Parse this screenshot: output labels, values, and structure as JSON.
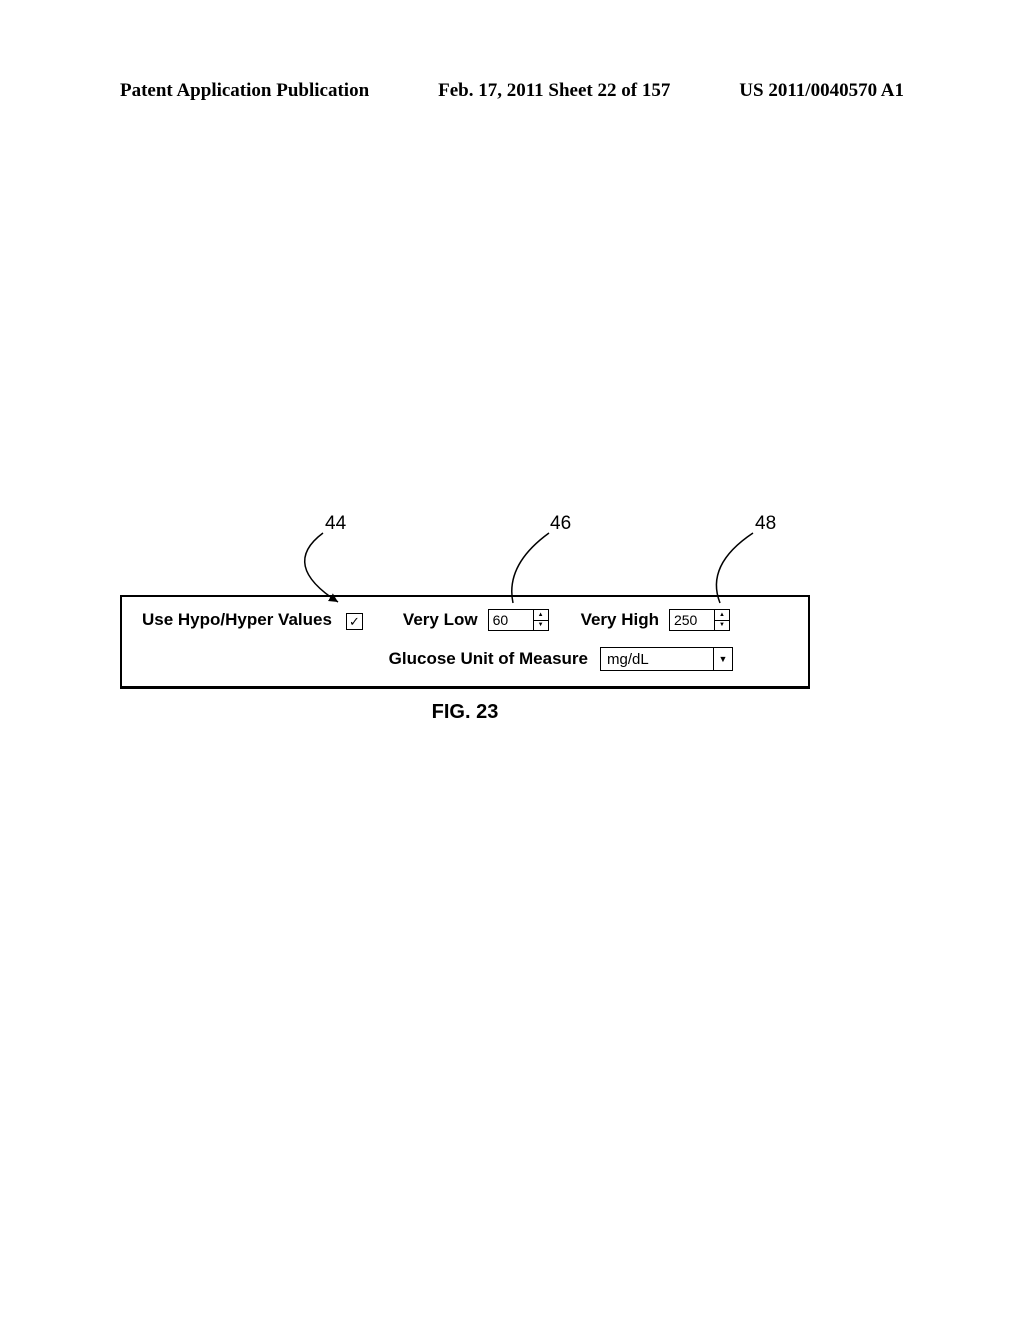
{
  "header": {
    "left": "Patent Application Publication",
    "center": "Feb. 17, 2011  Sheet 22 of 157",
    "right": "US 2011/0040570 A1"
  },
  "callouts": {
    "ref44": "44",
    "ref46": "46",
    "ref48": "48"
  },
  "form": {
    "use_hypo_hyper_label": "Use Hypo/Hyper Values",
    "checkbox_checked": "☑",
    "very_low_label": "Very Low",
    "very_low_value": "60",
    "very_high_label": "Very High",
    "very_high_value": "250",
    "unit_label": "Glucose Unit of Measure",
    "unit_value": "mg/dL"
  },
  "figure_label": "FIG. 23"
}
